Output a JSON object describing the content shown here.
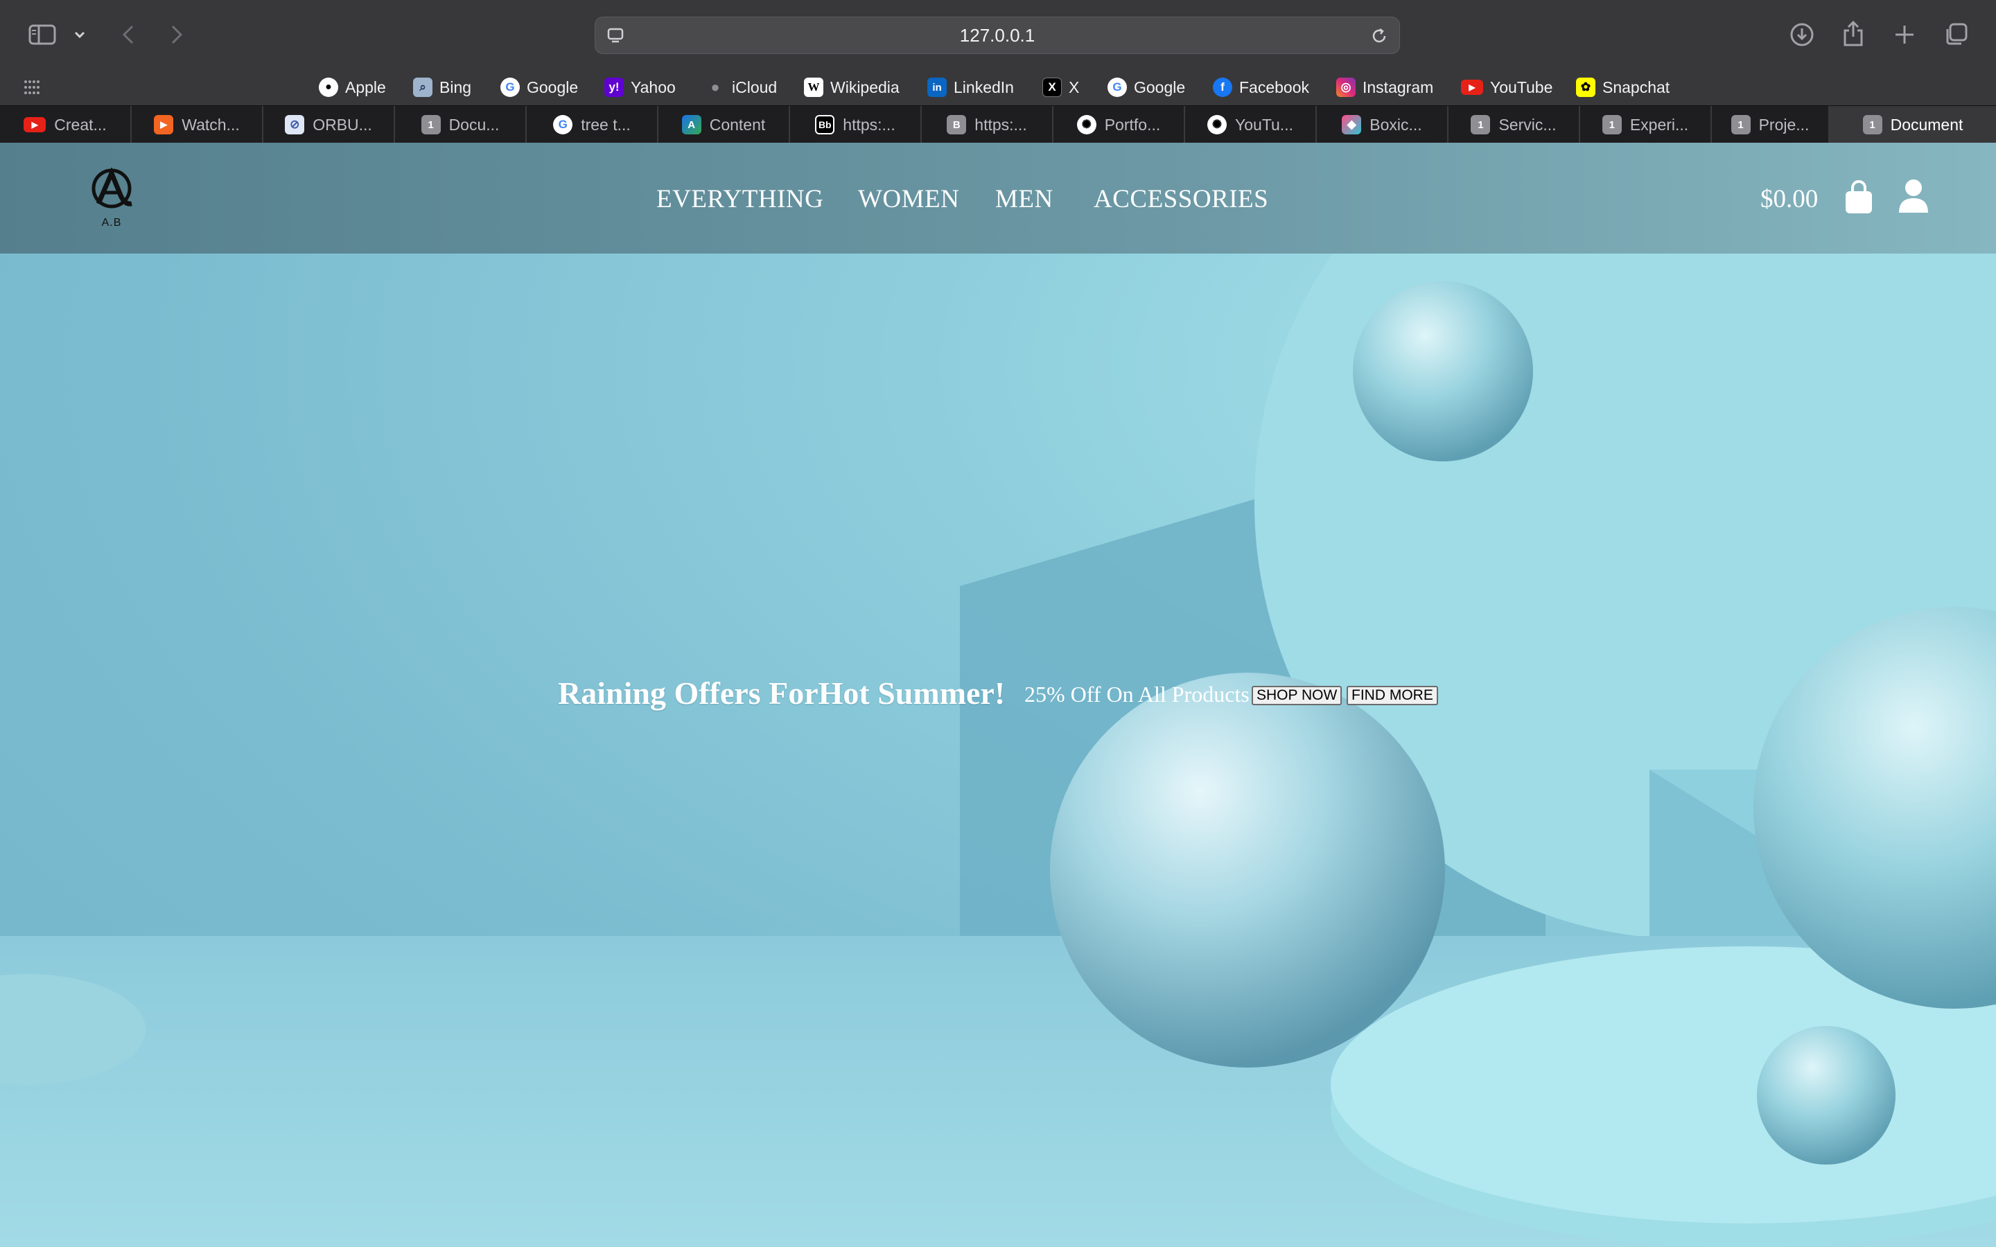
{
  "browser": {
    "url": "127.0.0.1",
    "toolbar_icons": [
      "sidebar-icon",
      "chevron-down-icon",
      "back-icon",
      "forward-icon",
      "download-icon",
      "share-icon",
      "new-tab-icon",
      "tab-overview-icon"
    ]
  },
  "bookmarks": [
    {
      "label": "Apple",
      "icon": "apple-icon",
      "color": "#ffffff"
    },
    {
      "label": "Bing",
      "icon": "bing-icon",
      "color": "#9db4cc"
    },
    {
      "label": "Google",
      "icon": "google-icon",
      "color": "#ffffff"
    },
    {
      "label": "Yahoo",
      "icon": "yahoo-icon",
      "color": "#6001d2"
    },
    {
      "label": "iCloud",
      "icon": "icloud-icon",
      "color": "#8e8e93"
    },
    {
      "label": "Wikipedia",
      "icon": "wikipedia-icon",
      "color": "#ffffff"
    },
    {
      "label": "LinkedIn",
      "icon": "linkedin-icon",
      "color": "#0a66c2"
    },
    {
      "label": "X",
      "icon": "x-icon",
      "color": "#000000"
    },
    {
      "label": "Google",
      "icon": "google-icon",
      "color": "#ffffff"
    },
    {
      "label": "Facebook",
      "icon": "facebook-icon",
      "color": "#1877f2"
    },
    {
      "label": "Instagram",
      "icon": "instagram-icon",
      "color": "#e1306c"
    },
    {
      "label": "YouTube",
      "icon": "youtube-icon",
      "color": "#e62117"
    },
    {
      "label": "Snapchat",
      "icon": "snapchat-icon",
      "color": "#fffc00"
    }
  ],
  "tabs": [
    {
      "label": "Creat...",
      "icon": "youtube-icon",
      "active": false
    },
    {
      "label": "Watch...",
      "icon": "play-icon",
      "active": false
    },
    {
      "label": "ORBU...",
      "icon": "orbit-icon",
      "active": false
    },
    {
      "label": "Docu...",
      "icon": "number-1-icon",
      "active": false
    },
    {
      "label": "tree t...",
      "icon": "google-icon",
      "active": false
    },
    {
      "label": "Content",
      "icon": "content-icon",
      "active": false
    },
    {
      "label": "https:...",
      "icon": "bb-icon",
      "active": false
    },
    {
      "label": "https:...",
      "icon": "b-icon",
      "active": false
    },
    {
      "label": "Portfo...",
      "icon": "openai-icon",
      "active": false
    },
    {
      "label": "YouTu...",
      "icon": "openai-icon",
      "active": false
    },
    {
      "label": "Boxic...",
      "icon": "boxicons-icon",
      "active": false
    },
    {
      "label": "Servic...",
      "icon": "number-1-icon",
      "active": false
    },
    {
      "label": "Experi...",
      "icon": "number-1-icon",
      "active": false
    },
    {
      "label": "Proje...",
      "icon": "number-1-icon",
      "active": false
    },
    {
      "label": "Document",
      "icon": "number-1-icon",
      "active": true
    }
  ],
  "site": {
    "logo_text": "A.B",
    "nav": [
      "EVERYTHING",
      "WOMEN",
      "MEN",
      "ACCESSORIES"
    ],
    "cart_total": "$0.00",
    "hero": {
      "title": "Raining Offers ForHot Summer!",
      "subtitle": "25% Off On All Products",
      "buttons": [
        "SHOP NOW",
        "FIND MORE"
      ]
    }
  }
}
